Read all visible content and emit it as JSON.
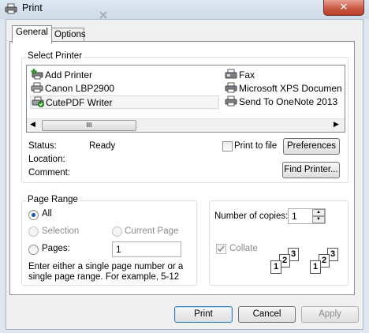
{
  "window": {
    "title": "Print",
    "close_label": "✕"
  },
  "tabs": [
    {
      "label": "General",
      "active": true
    },
    {
      "label": "Options",
      "active": false
    }
  ],
  "select_printer": {
    "label": "Select Printer",
    "printers_left": [
      {
        "name": "Add Printer",
        "icon": "add-printer-icon"
      },
      {
        "name": "Canon LBP2900",
        "icon": "printer-icon"
      },
      {
        "name": "CutePDF Writer",
        "icon": "default-printer-icon",
        "selected": true
      }
    ],
    "printers_right": [
      {
        "name": "Fax",
        "icon": "fax-icon"
      },
      {
        "name": "Microsoft XPS Documen",
        "icon": "printer-icon"
      },
      {
        "name": "Send To OneNote 2013",
        "icon": "printer-icon"
      }
    ],
    "scroll_grip": "III"
  },
  "status": {
    "status_label": "Status:",
    "status_value": "Ready",
    "location_label": "Location:",
    "comment_label": "Comment:",
    "print_to_file_label": "Print to file",
    "preferences_label": "Preferences",
    "find_printer_label": "Find Printer..."
  },
  "page_range": {
    "label": "Page Range",
    "all_label": "All",
    "selection_label": "Selection",
    "current_page_label": "Current Page",
    "pages_label": "Pages:",
    "pages_value": "1",
    "help_text": "Enter either a single page number or a single page range.  For example, 5-12"
  },
  "copies": {
    "label": "Number of copies:",
    "value": "1",
    "collate_label": "Collate"
  },
  "buttons": {
    "print": "Print",
    "cancel": "Cancel",
    "apply": "Apply"
  },
  "collate_numbers": [
    "1",
    "2",
    "3"
  ]
}
